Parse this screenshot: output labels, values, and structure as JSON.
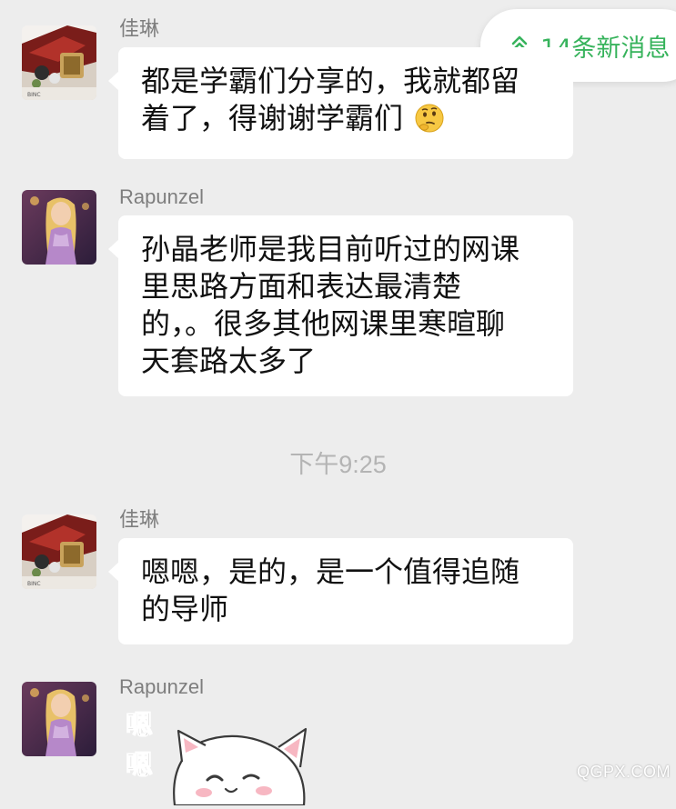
{
  "new_messages": {
    "label": "14条新消息",
    "icon": "double-chevron-up-icon",
    "color": "#37b35c"
  },
  "messages": [
    {
      "sender": "佳琳",
      "text": "都是学霸们分享的，我就都留\n着了，得谢谢学霸们",
      "emoji": "thinking-face-icon"
    },
    {
      "sender": "Rapunzel",
      "text": "孙晶老师是我目前听过的网课\n里思路方面和表达最清楚\n的，。很多其他网课里寒暄聊\n天套路太多了"
    },
    {
      "sender": "佳琳",
      "text": "嗯嗯，是的，是一个值得追随\n的导师"
    },
    {
      "sender": "Rapunzel",
      "sticker_text": [
        "嗯",
        "嗯"
      ],
      "sticker": "white-cat-sticker"
    }
  ],
  "time_divider": "下午9:25",
  "watermark": "QGPX.COM",
  "colors": {
    "background": "#ededed",
    "bubble": "#ffffff",
    "sender_name": "#7e7e7e",
    "time_label": "#b4b4b4",
    "accent_green": "#37b35c"
  }
}
